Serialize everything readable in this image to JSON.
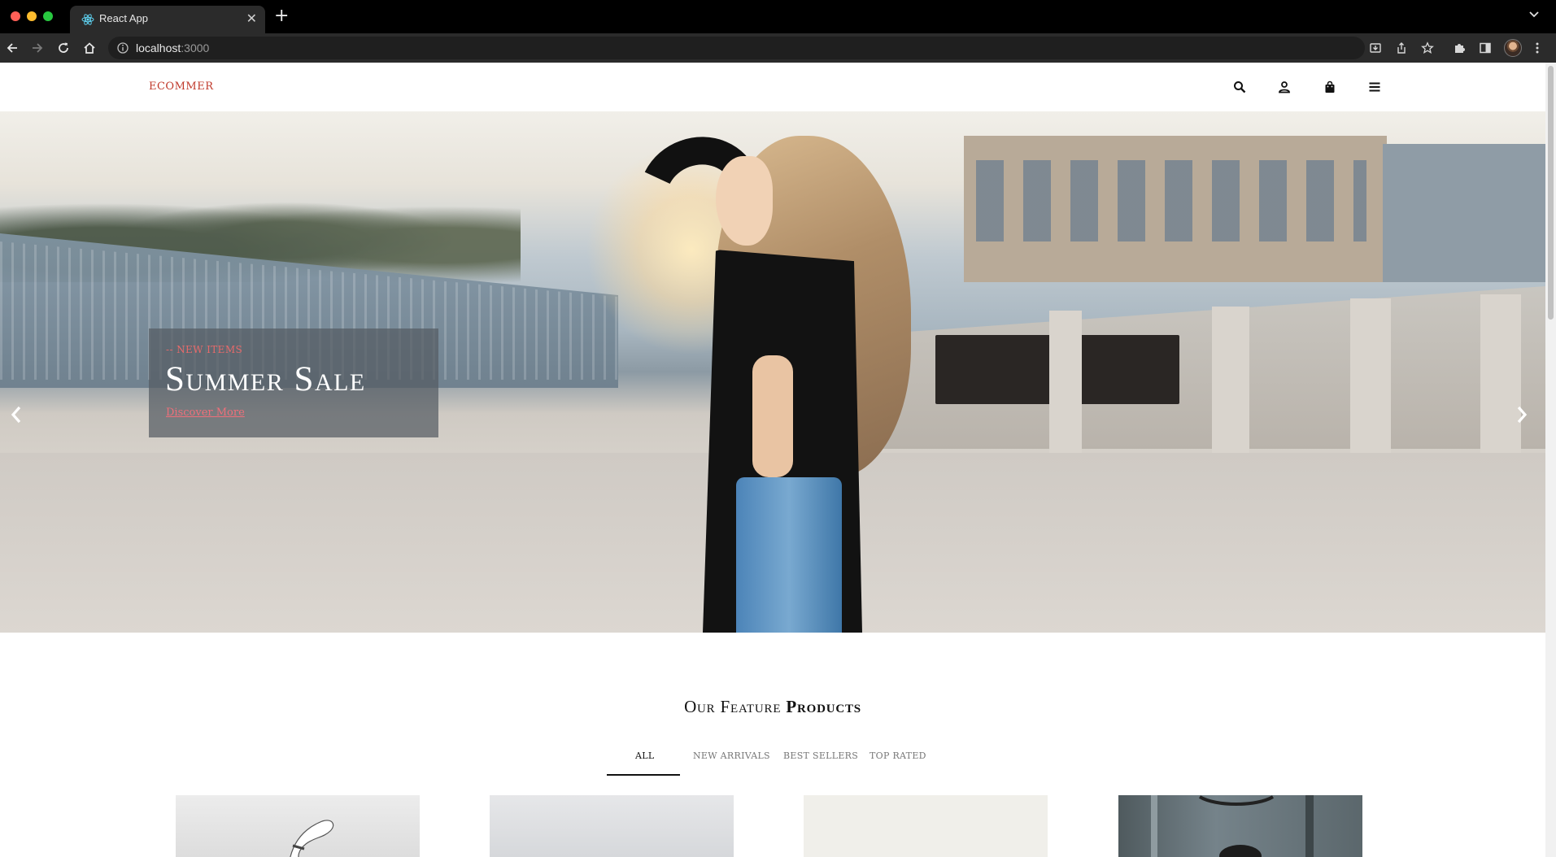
{
  "browser": {
    "tab_title": "React App",
    "tab_close": "✕",
    "new_tab": "+",
    "url_host": "localhost",
    "url_port": ":3000"
  },
  "site": {
    "logo": "ECOMMER"
  },
  "hero": {
    "kicker": "-- NEW ITEMS",
    "title": "Summer Sale",
    "link": "Discover More"
  },
  "featured": {
    "title_light": "Our Feature",
    "title_bold": "Products",
    "tabs": [
      {
        "label": "ALL",
        "active": true
      },
      {
        "label": "NEW ARRIVALS",
        "active": false
      },
      {
        "label": "BEST SELLERS",
        "active": false
      },
      {
        "label": "TOP RATED",
        "active": false
      }
    ]
  },
  "products": [
    {
      "image": "hand-with-bracelet-photo"
    },
    {
      "image": "grey-product-photo"
    },
    {
      "image": "beige-product-photo"
    },
    {
      "image": "dark-street-photo"
    }
  ],
  "colors": {
    "accent": "#c0392b",
    "link": "#ef6f7a",
    "caption_bg": "#555c62"
  }
}
